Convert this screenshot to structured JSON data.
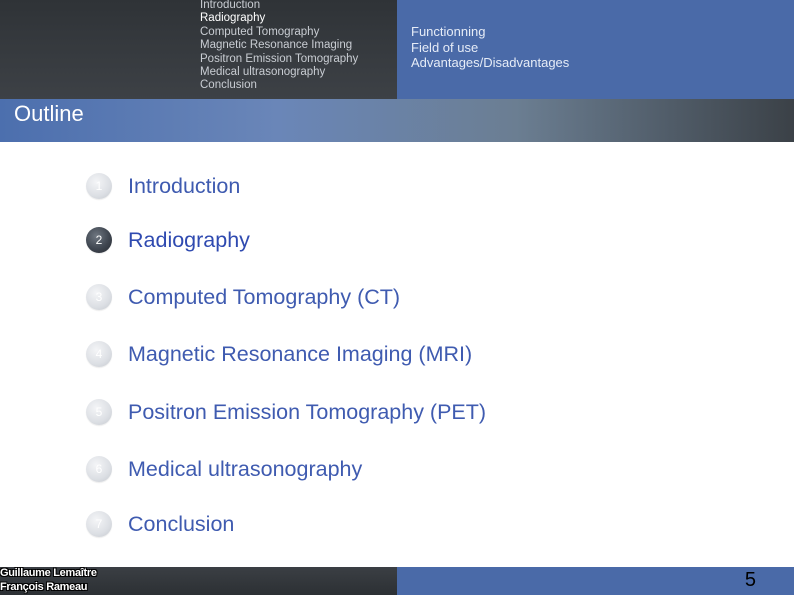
{
  "header": {
    "nav": [
      "Introduction",
      "Radiography",
      "Computed Tomography",
      "Magnetic Resonance Imaging",
      "Positron Emission Tomography",
      "Medical ultrasonography",
      "Conclusion"
    ],
    "subsections": [
      "Functionning",
      "Field of use",
      "Advantages/Disadvantages"
    ]
  },
  "title": "Outline",
  "outline": [
    {
      "num": "1",
      "label": "Introduction"
    },
    {
      "num": "2",
      "label": "Radiography"
    },
    {
      "num": "3",
      "label": "Computed Tomography (CT)"
    },
    {
      "num": "4",
      "label": "Magnetic Resonance Imaging (MRI)"
    },
    {
      "num": "5",
      "label": "Positron Emission Tomography (PET)"
    },
    {
      "num": "6",
      "label": "Medical ultrasonography"
    },
    {
      "num": "7",
      "label": "Conclusion"
    }
  ],
  "footer": {
    "authors": [
      "Guillaume Lemaître",
      "François Rameau"
    ],
    "page": "5"
  },
  "colors": {
    "accent_blue": "#4a6aa8",
    "dark_panel": "#3a3e43",
    "item_text": "#3f5bb0"
  }
}
